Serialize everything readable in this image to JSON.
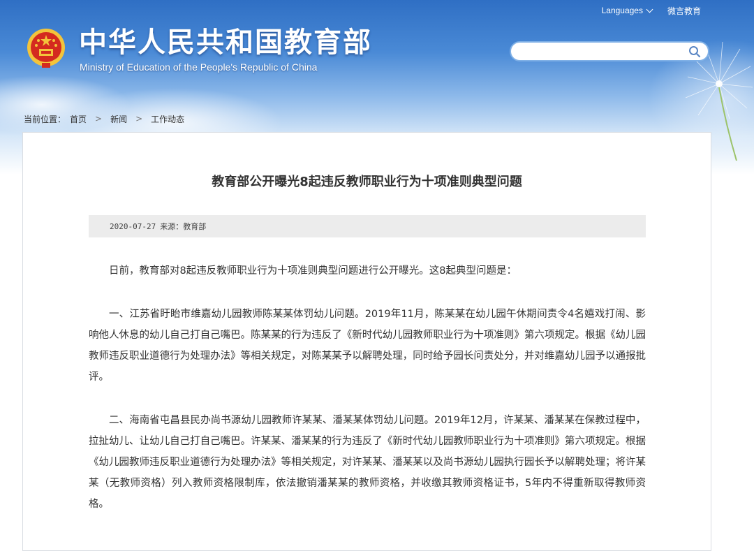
{
  "header": {
    "title": "中华人民共和国教育部",
    "subtitle": "Ministry of Education of the People's Republic of China",
    "languages_label": "Languages",
    "weibo_label": "微言教育",
    "search": {
      "placeholder": "",
      "value": ""
    }
  },
  "breadcrumb": {
    "prefix": "当前位置：",
    "items": [
      "首页",
      "新闻",
      "工作动态"
    ]
  },
  "article": {
    "title": "教育部公开曝光8起违反教师职业行为十项准则典型问题",
    "date": "2020-07-27",
    "source_label": "来源：",
    "source": "教育部",
    "paragraphs": [
      "日前，教育部对8起违反教师职业行为十项准则典型问题进行公开曝光。这8起典型问题是：",
      "一、江苏省盱眙市维嘉幼儿园教师陈某某体罚幼儿问题。2019年11月，陈某某在幼儿园午休期间责令4名嬉戏打闹、影响他人休息的幼儿自己打自己嘴巴。陈某某的行为违反了《新时代幼儿园教师职业行为十项准则》第六项规定。根据《幼儿园教师违反职业道德行为处理办法》等相关规定，对陈某某予以解聘处理，同时给予园长问责处分，并对维嘉幼儿园予以通报批评。",
      "二、海南省屯昌县民办尚书源幼儿园教师许某某、潘某某体罚幼儿问题。2019年12月，许某某、潘某某在保教过程中，拉扯幼儿、让幼儿自己打自己嘴巴。许某某、潘某某的行为违反了《新时代幼儿园教师职业行为十项准则》第六项规定。根据《幼儿园教师违反职业道德行为处理办法》等相关规定，对许某某、潘某某以及尚书源幼儿园执行园长予以解聘处理；将许某某（无教师资格）列入教师资格限制库，依法撤销潘某某的教师资格，并收缴其教师资格证书，5年内不得重新取得教师资格。"
    ]
  },
  "colors": {
    "header_blue": "#2f6fc4",
    "emblem_red": "#d42a1f",
    "emblem_gold": "#f3c43b",
    "meta_bar": "#ececec",
    "text": "#333333"
  },
  "icons": [
    "national-emblem-icon",
    "search-icon",
    "chevron-down-icon",
    "breadcrumb-arrow-icon"
  ]
}
